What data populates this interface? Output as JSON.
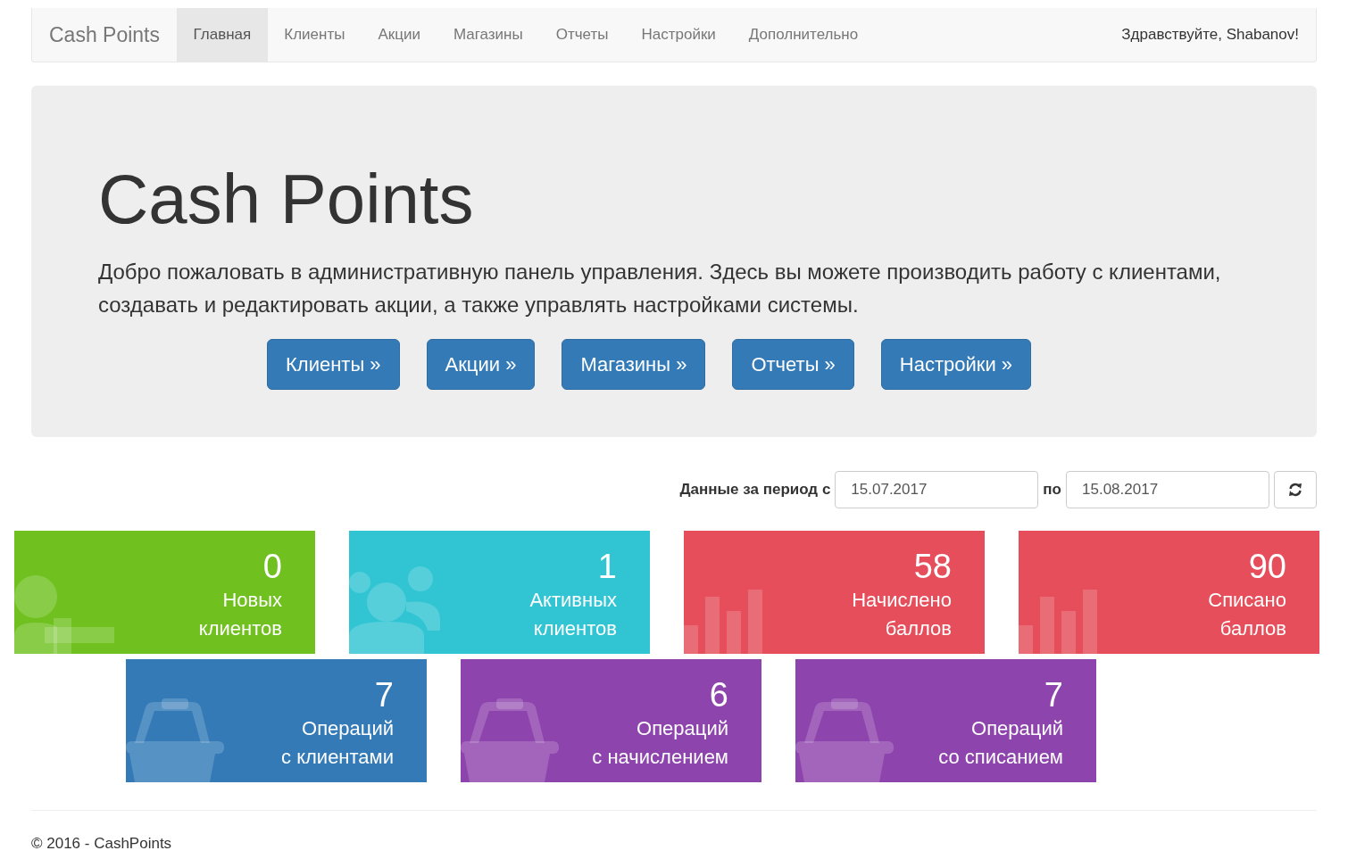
{
  "navbar": {
    "brand": "Cash Points",
    "items": [
      {
        "label": "Главная",
        "selected": true
      },
      {
        "label": "Клиенты",
        "selected": false
      },
      {
        "label": "Акции",
        "selected": false
      },
      {
        "label": "Магазины",
        "selected": false
      },
      {
        "label": "Отчеты",
        "selected": false
      },
      {
        "label": "Настройки",
        "selected": false
      },
      {
        "label": "Дополнительно",
        "selected": false
      }
    ],
    "greeting": "Здравствуйте, Shabanov!"
  },
  "jumbotron": {
    "title": "Cash Points",
    "text": "Добро пожаловать в административную панель управления. Здесь вы можете производить работу с клиентами, создавать и редактировать акции, а также управлять настройками системы.",
    "buttons": [
      "Клиенты »",
      "Акции »",
      "Магазины »",
      "Отчеты »",
      "Настройки »"
    ]
  },
  "period": {
    "label_from": "Данные за период с",
    "from": "15.07.2017",
    "label_to": "по",
    "to": "15.08.2017"
  },
  "tile_rows": [
    [
      {
        "kind": "user-plus",
        "color": "#70c11f",
        "value": "0",
        "label_lines": [
          "Новых",
          "клиентов"
        ]
      },
      {
        "kind": "users",
        "color": "#31c5d4",
        "value": "1",
        "label_lines": [
          "Активных",
          "клиентов"
        ]
      },
      {
        "kind": "bar-chart",
        "color": "#e54e5a",
        "value": "58",
        "label_lines": [
          "Начислено",
          "баллов"
        ]
      },
      {
        "kind": "bar-chart",
        "color": "#e54e5a",
        "value": "90",
        "label_lines": [
          "Списано",
          "баллов"
        ]
      }
    ],
    [
      {
        "kind": "basket",
        "color": "#337ab7",
        "value": "7",
        "label_lines": [
          "Операций",
          "с клиентами"
        ]
      },
      {
        "kind": "basket",
        "color": "#8e44ad",
        "value": "6",
        "label_lines": [
          "Операций",
          "с начислением"
        ]
      },
      {
        "kind": "basket",
        "color": "#8e44ad",
        "value": "7",
        "label_lines": [
          "Операций",
          "со списанием"
        ]
      }
    ]
  ],
  "footer": "© 2016 - CashPoints"
}
